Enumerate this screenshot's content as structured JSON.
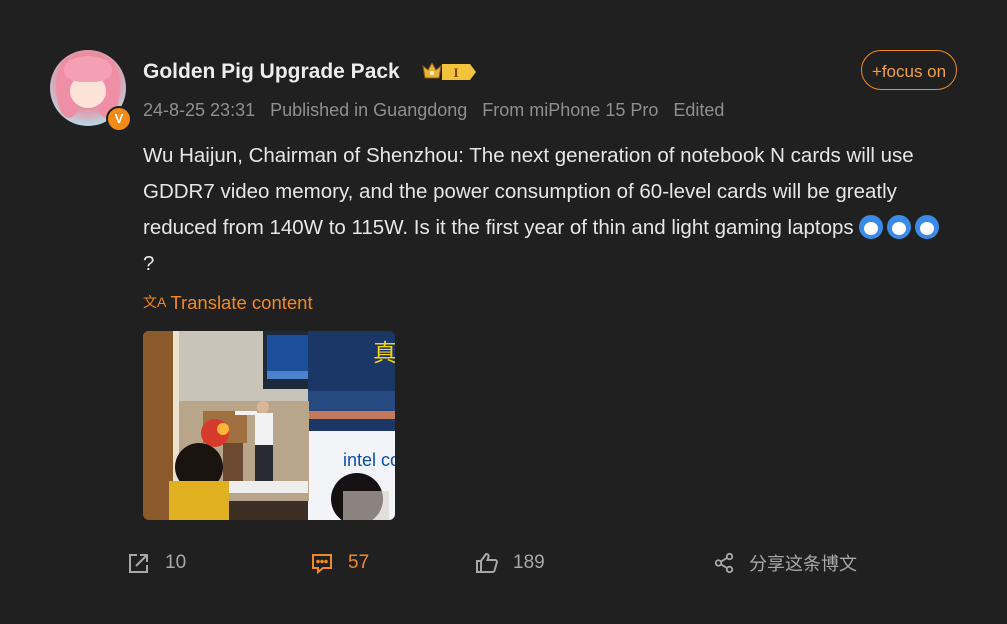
{
  "post": {
    "author": "Golden Pig Upgrade Pack",
    "verified_mark": "V",
    "level_badge": "I",
    "follow_label": "+focus on",
    "timestamp": "24-8-25 23:31",
    "published_in": "Published in Guangdong",
    "source": "From miPhone 15 Pro",
    "edited": "Edited",
    "text": "Wu Haijun, Chairman of Shenzhou: The next generation of notebook N cards will use GDDR7 video memory, and the power consumption of 60-level cards will be greatly reduced from 140W to 115W. Is it the first year of thin and light gaming laptops",
    "text_suffix": "?",
    "translate_label": "Translate content",
    "image": {
      "screen_text": "Intel",
      "banner_text": "intel co",
      "banner_glyph": "真"
    }
  },
  "actions": {
    "repost_count": "10",
    "comment_count": "57",
    "like_count": "189",
    "share_label": "分享这条博文"
  },
  "colors": {
    "accent": "#f08a25",
    "background": "#202020"
  }
}
